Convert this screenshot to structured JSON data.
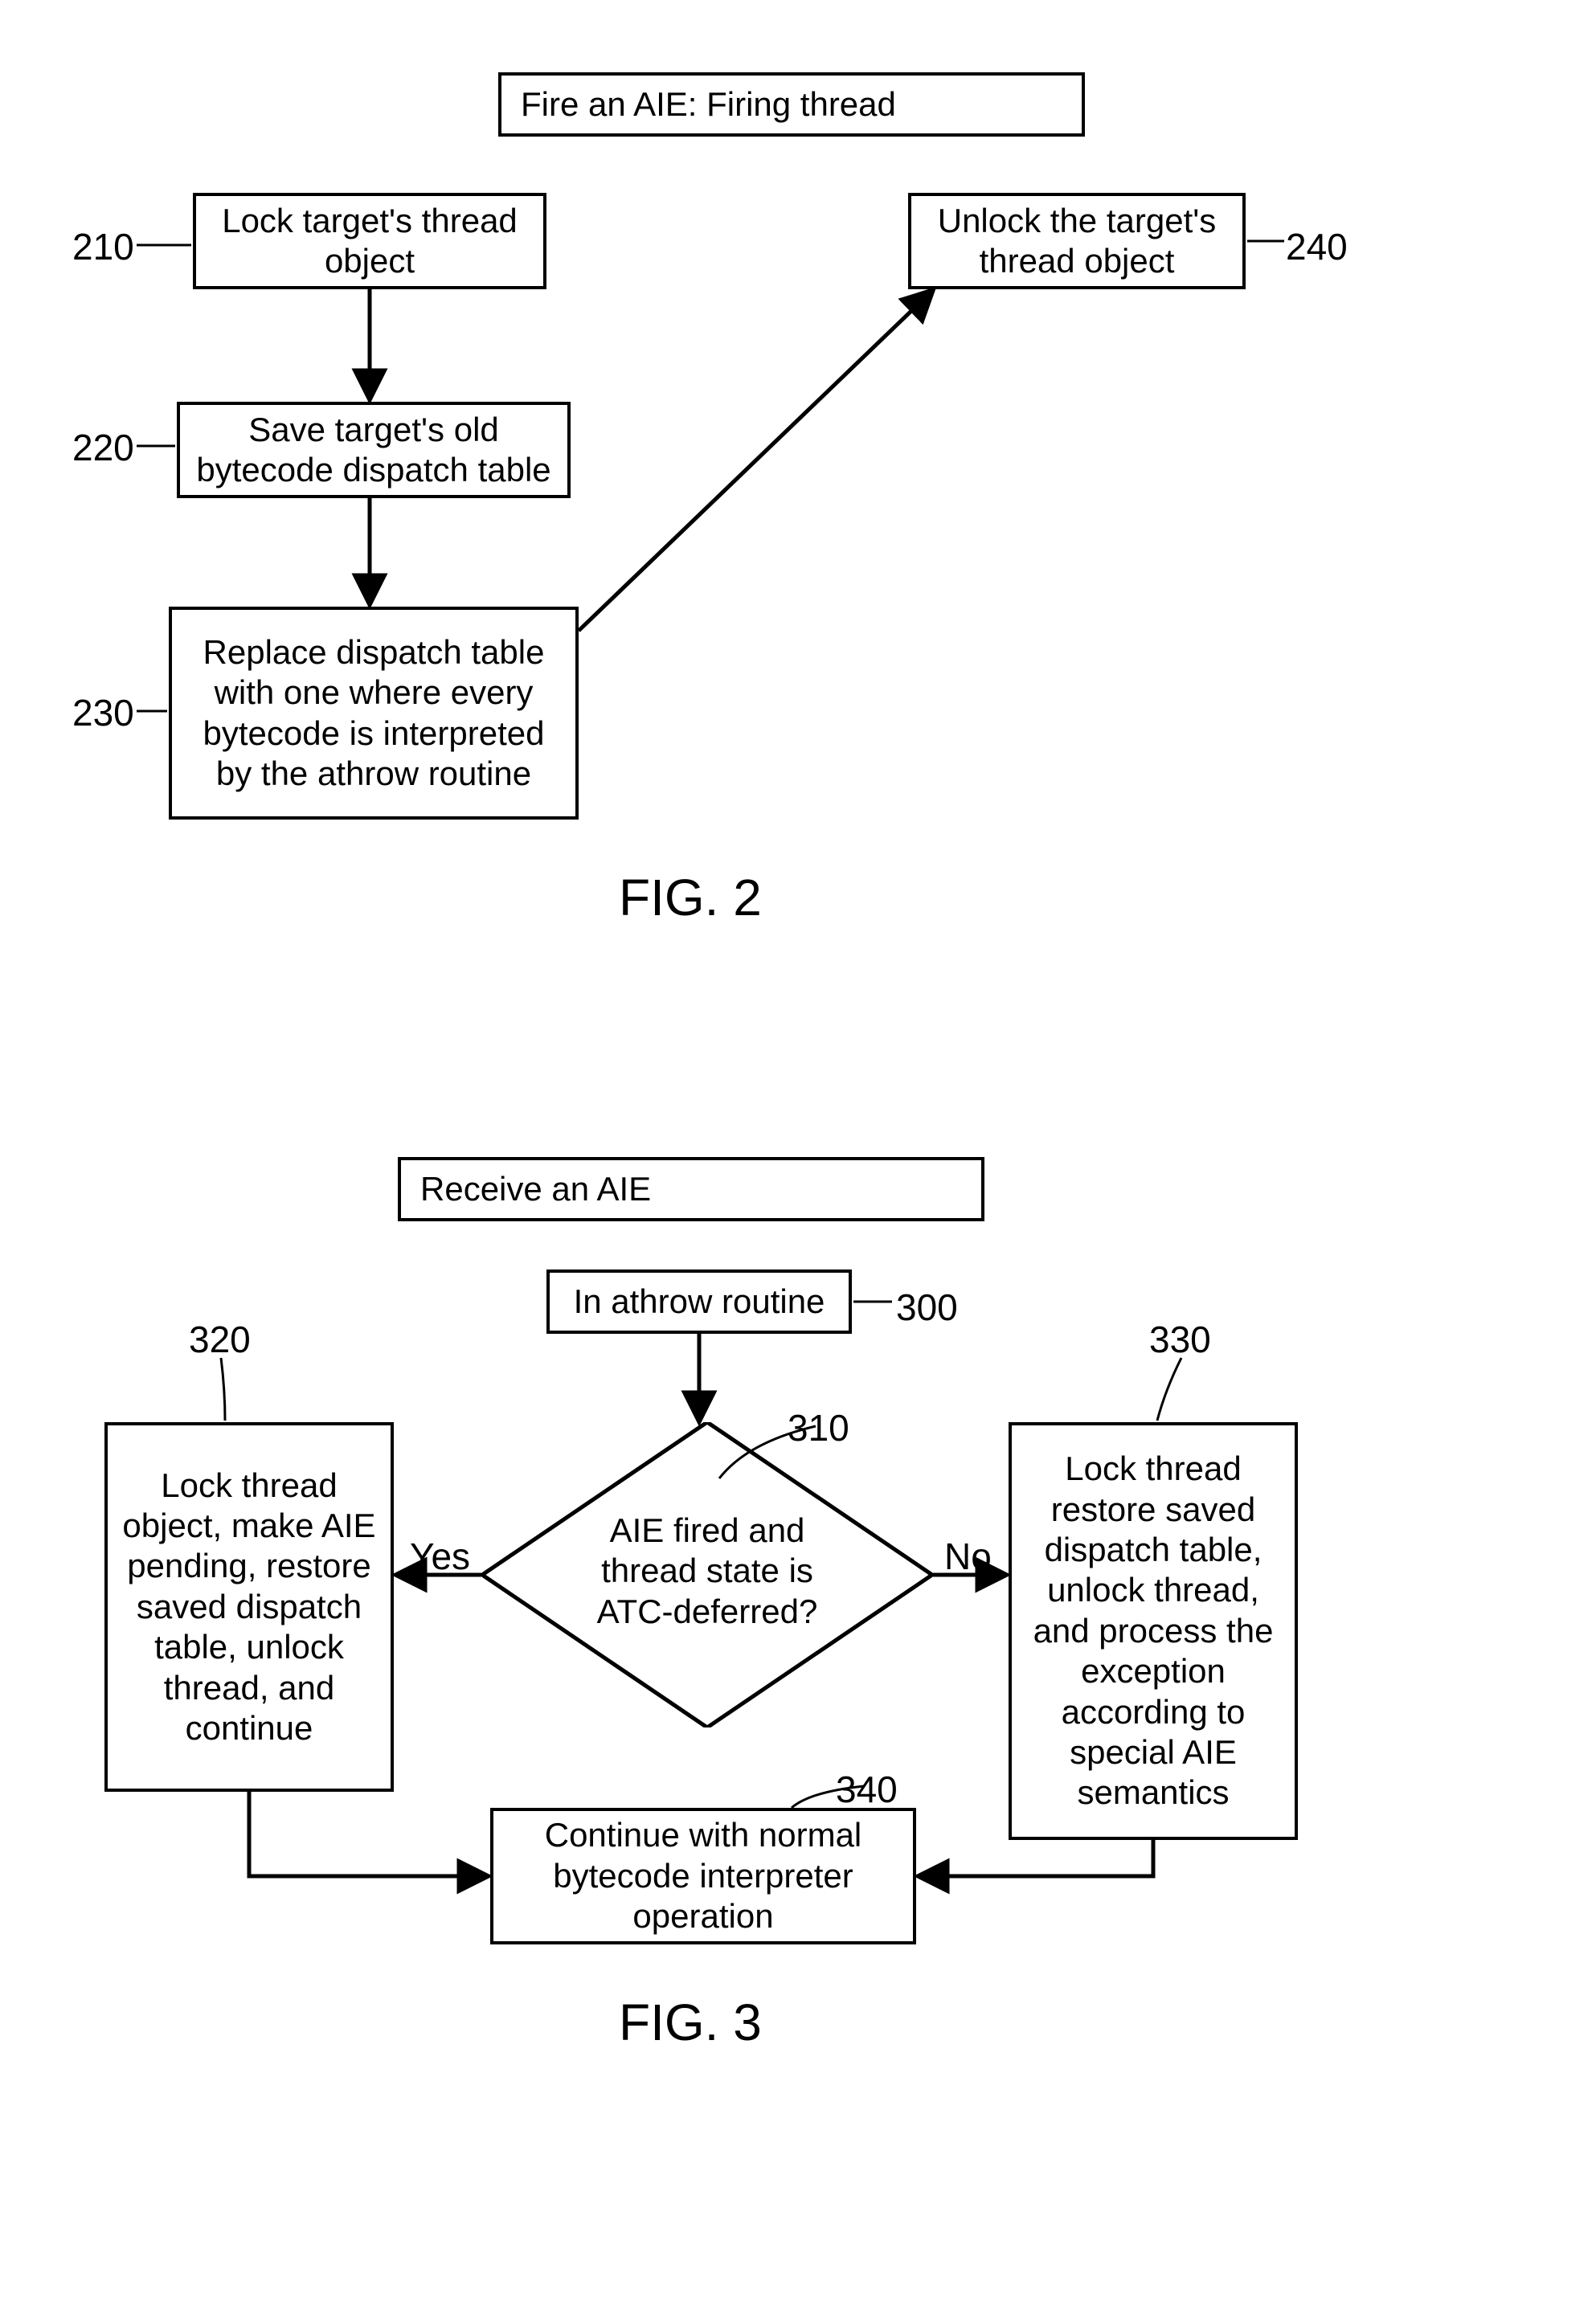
{
  "fig2": {
    "title": "Fire an AIE: Firing thread",
    "caption": "FIG. 2",
    "ref210": "210",
    "ref220": "220",
    "ref230": "230",
    "ref240": "240",
    "box210": "Lock target's thread object",
    "box220": "Save target's old bytecode dispatch table",
    "box230": "Replace dispatch table with one where every bytecode is interpreted by the athrow routine",
    "box240": "Unlock the target's thread object"
  },
  "fig3": {
    "title": "Receive an AIE",
    "caption": "FIG. 3",
    "ref300": "300",
    "ref310": "310",
    "ref320": "320",
    "ref330": "330",
    "ref340": "340",
    "box300": "In athrow routine",
    "box310": "AIE fired and thread state is ATC-deferred?",
    "box320": "Lock thread object, make AIE pending, restore saved dispatch table, unlock thread, and continue",
    "box330": "Lock thread restore saved dispatch table, unlock thread, and process the exception according to special AIE semantics",
    "box340": "Continue with normal bytecode interpreter operation",
    "yes": "Yes",
    "no": "No"
  }
}
